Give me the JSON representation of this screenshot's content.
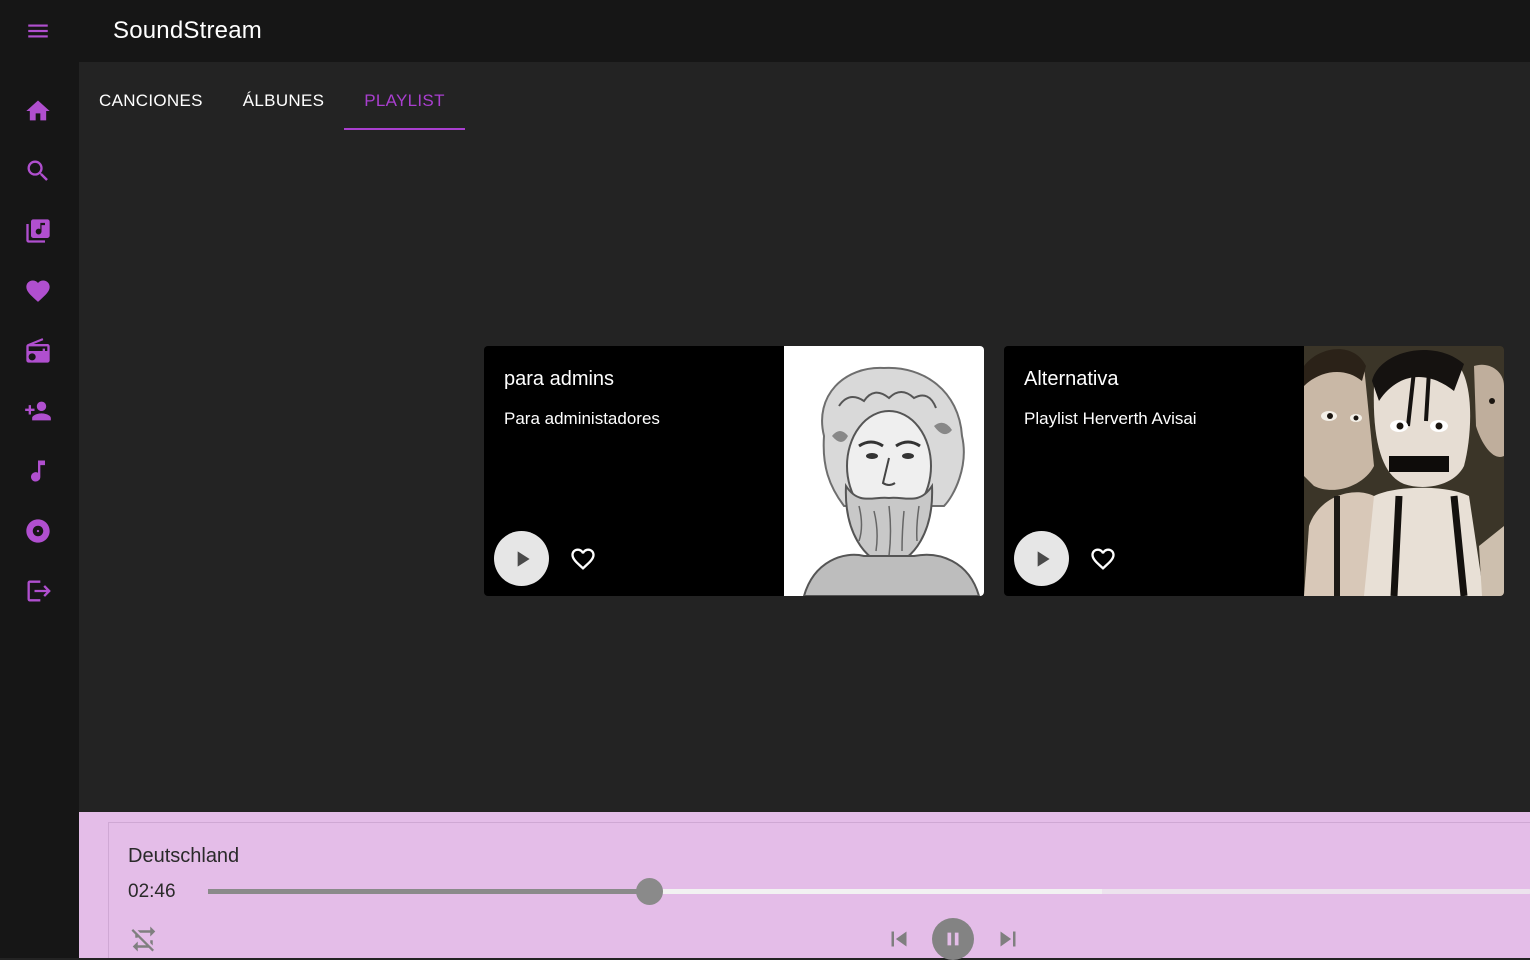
{
  "app": {
    "title": "SoundStream",
    "accent": "#a93fcf"
  },
  "header": {
    "menu_icon": "menu-icon"
  },
  "sidebar": {
    "items": [
      {
        "name": "home",
        "icon": "home-icon"
      },
      {
        "name": "search",
        "icon": "search-icon"
      },
      {
        "name": "library",
        "icon": "library-music-icon"
      },
      {
        "name": "favorites",
        "icon": "heart-icon"
      },
      {
        "name": "radio",
        "icon": "radio-icon"
      },
      {
        "name": "add-user",
        "icon": "person-add-icon"
      },
      {
        "name": "songs",
        "icon": "music-note-icon"
      },
      {
        "name": "albums",
        "icon": "album-icon"
      },
      {
        "name": "logout",
        "icon": "logout-icon"
      }
    ]
  },
  "tabs": [
    {
      "label": "CANCIONES",
      "active": false
    },
    {
      "label": "ÁLBUNES",
      "active": false
    },
    {
      "label": "PLAYLIST",
      "active": true
    }
  ],
  "playlists": [
    {
      "title": "para admins",
      "subtitle": "Para administadores",
      "cover": "engraved-portrait-bearded-man"
    },
    {
      "title": "Alternativa",
      "subtitle": "Playlist Herverth Avisai",
      "cover": "two-pale-faces-suspenders"
    }
  ],
  "player": {
    "song": "Deutschland",
    "elapsed": "02:46",
    "progress": 0.333,
    "buffered": 0.676,
    "state": "playing",
    "background": "#e4bde8"
  }
}
